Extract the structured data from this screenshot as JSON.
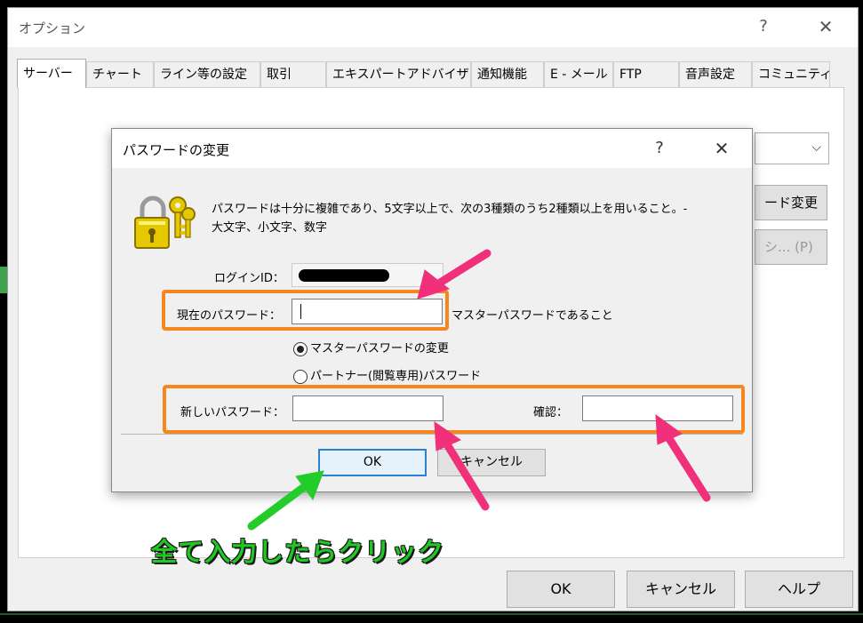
{
  "outer_window": {
    "title": "オプション",
    "help_glyph": "?",
    "close_glyph": "✕",
    "tabs": [
      {
        "label": "サーバー",
        "active": true
      },
      {
        "label": "チャート",
        "active": false
      },
      {
        "label": "ライン等の設定",
        "active": false
      },
      {
        "label": "取引",
        "active": false
      },
      {
        "label": "エキスパートアドバイザ",
        "active": false
      },
      {
        "label": "通知機能",
        "active": false
      },
      {
        "label": "E - メール",
        "active": false
      },
      {
        "label": "FTP",
        "active": false
      },
      {
        "label": "音声設定",
        "active": false
      },
      {
        "label": "コミュニティ",
        "active": false
      }
    ],
    "partial_button_1": "ード変更",
    "partial_button_2": "シ... (P)",
    "buttons": {
      "ok": "OK",
      "cancel": "キャンセル",
      "help": "ヘルプ"
    }
  },
  "dialog": {
    "title": "パスワードの変更",
    "help_glyph": "?",
    "close_glyph": "✕",
    "info_line1": "パスワードは十分に複雑であり、5文字以上で、次の3種類のうち2種類以上を用いること。-",
    "info_line2": "大文字、小文字、数字",
    "login_label": "ログインID：",
    "current_label": "現在のパスワード：",
    "current_value": "",
    "master_note": "マスターパスワードであること",
    "radio_master": {
      "label": "マスターパスワードの変更",
      "selected": true
    },
    "radio_partner": {
      "label": "パートナー(閲覧専用)パスワード",
      "selected": false
    },
    "new_label": "新しいパスワード：",
    "new_value": "",
    "confirm_label": "確認：",
    "confirm_value": "",
    "ok_label": "OK",
    "cancel_label": "キャンセル"
  },
  "annotation": {
    "caption": "全て入力したらクリック",
    "caption_color": "#21c722",
    "highlight_color": "#f6861f",
    "arrow_color": "#f0307a"
  }
}
